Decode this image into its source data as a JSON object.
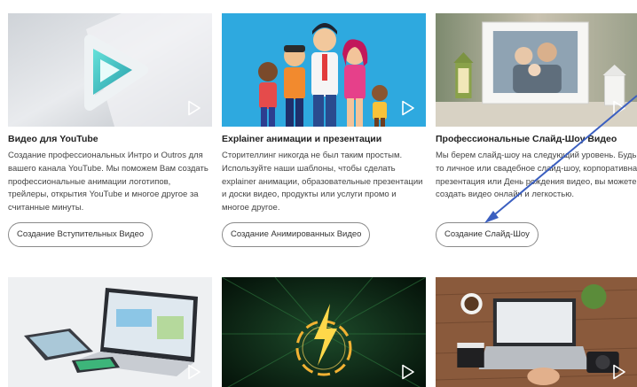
{
  "cards": [
    {
      "title": "Видео для YouTube",
      "desc": "Создание профессиональных Интро и Outros для вашего канала YouTube. Мы поможем Вам создать профессиональные анимации логотипов, трейлеры, открытия YouTube и многое другое за считанные минуты.",
      "button": "Создание Вступительных Видео"
    },
    {
      "title": "Explainer анимации и презентации",
      "desc": "Сторителлинг никогда не был таким простым. Используйте наши шаблоны, чтобы сделать explainer анимации, образовательные презентации и доски видео, продукты или услуги промо и многое другое.",
      "button": "Создание Анимированных Видео"
    },
    {
      "title": "Профессиональные Слайд-Шоу Видео",
      "desc": "Мы берем слайд-шоу на следующий уровень. Будь то личное или свадебное слайд-шоу, корпоративная презентация или День рождения видео, вы можете создать видео онлайн и легкостью.",
      "button": "Создание Слайд-Шоу"
    }
  ],
  "colors": {
    "annotation_arrow": "#3b5fc0",
    "button_border": "#8a8a8a",
    "play_icon": "#ffffff"
  }
}
